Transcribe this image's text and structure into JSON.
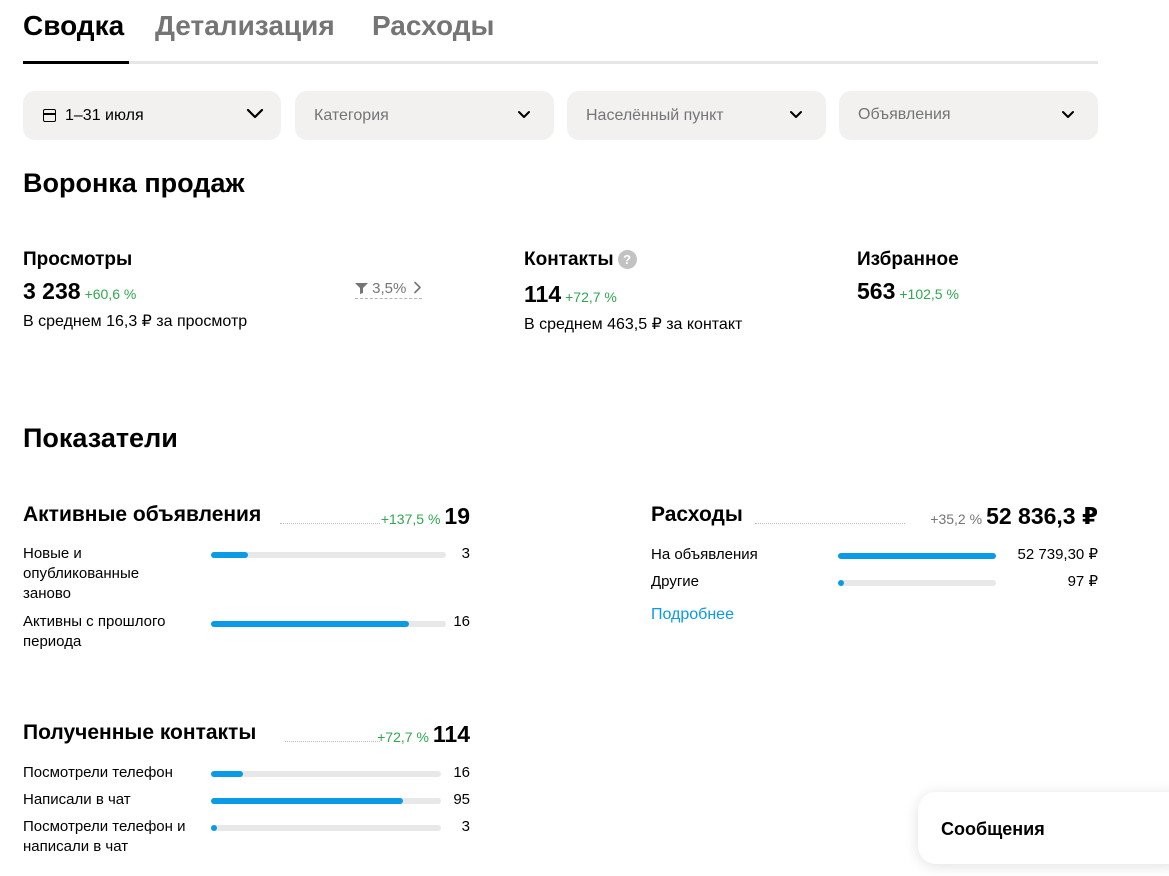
{
  "tabs": [
    {
      "label": "Сводка",
      "active": true
    },
    {
      "label": "Детализация",
      "active": false
    },
    {
      "label": "Расходы",
      "active": false
    }
  ],
  "filters": {
    "period": "1–31 июля",
    "category": "Категория",
    "city": "Населённый пункт",
    "ads": "Объявления"
  },
  "funnel": {
    "title": "Воронка продаж",
    "views": {
      "title": "Просмотры",
      "value": "3 238",
      "delta": "+60,6 %",
      "sub": "В среднем 16,3 ₽ за просмотр"
    },
    "conversion": "3,5%",
    "contacts": {
      "title": "Контакты",
      "value": "114",
      "delta": "+72,7 %",
      "sub": "В среднем 463,5 ₽ за контакт",
      "help": "?"
    },
    "favorites": {
      "title": "Избранное",
      "value": "563",
      "delta": "+102,5 %"
    }
  },
  "indicators": {
    "title": "Показатели",
    "active_ads": {
      "title": "Активные объявления",
      "delta": "+137,5 %",
      "total": "19",
      "rows": [
        {
          "label": "Новые и опубликованные заново",
          "value": "3",
          "fill": 0.158
        },
        {
          "label": "Активны с прошлого периода",
          "value": "16",
          "fill": 0.842
        }
      ]
    },
    "contacts_received": {
      "title": "Полученные контакты",
      "delta": "+72,7 %",
      "total": "114",
      "rows": [
        {
          "label": "Посмотрели телефон",
          "value": "16",
          "fill": 0.14
        },
        {
          "label": "Написали в чат",
          "value": "95",
          "fill": 0.833
        },
        {
          "label": "Посмотрели телефон и написали в чат",
          "value": "3",
          "fill": 0.026
        }
      ]
    },
    "expenses": {
      "title": "Расходы",
      "delta": "+35,2 %",
      "total": "52 836,3 ₽",
      "rows": [
        {
          "label": "На объявления",
          "value": "52 739,30 ₽",
          "fill": 0.998
        },
        {
          "label": "Другие",
          "value": "97 ₽",
          "fill": 0.03
        }
      ],
      "more_link": "Подробнее"
    }
  },
  "messages": {
    "label": "Сообщения"
  },
  "colors": {
    "accent": "#0a9ae6",
    "positive": "#2fa84f",
    "muted": "#757575",
    "filter_bg": "#f2f1f0"
  }
}
